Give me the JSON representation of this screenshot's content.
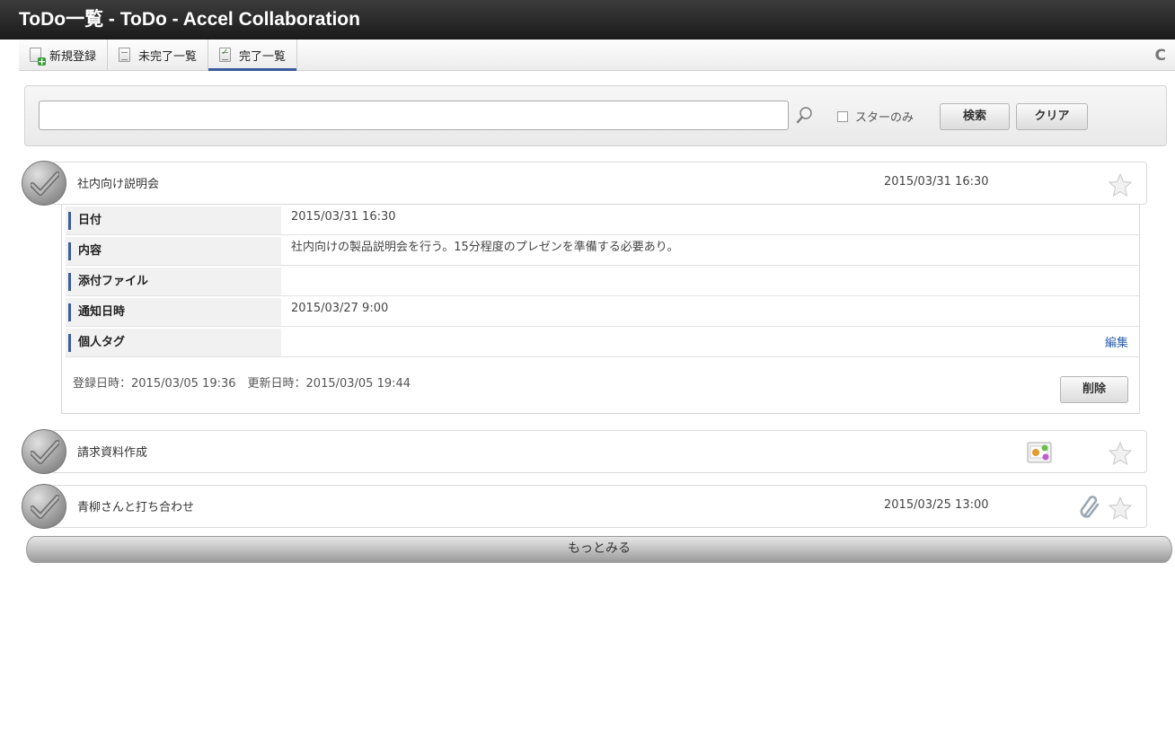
{
  "window": {
    "title": "ToDo一覧 - ToDo - Accel Collaboration"
  },
  "toolbar": {
    "new_label": "新規登録",
    "incomplete_label": "未完了一覧",
    "complete_label": "完了一覧",
    "active_tab": "完了一覧",
    "refresh_icon": "refresh-icon"
  },
  "search": {
    "value": "",
    "placeholder": "",
    "star_only_label": "スターのみ",
    "star_only_checked": false,
    "search_label": "検索",
    "clear_label": "クリア"
  },
  "todos": [
    {
      "title": "社内向け説明会",
      "date": "2015/03/31 16:30",
      "starred": false,
      "expanded": true,
      "details": {
        "date_label": "日付",
        "date_value": "2015/03/31 16:30",
        "content_label": "内容",
        "content_value": "社内向けの製品説明会を行う。15分程度のプレゼンを準備する必要あり。",
        "attachment_label": "添付ファイル",
        "attachment_value": "",
        "notify_label": "通知日時",
        "notify_value": "2015/03/27 9:00",
        "tag_label": "個人タグ",
        "tag_value": "",
        "edit_label": "編集",
        "meta": "登録日時：2015/03/05 19:36　更新日時：2015/03/05 19:44",
        "delete_label": "削除"
      }
    },
    {
      "title": "請求資料作成",
      "date": "",
      "starred": false,
      "expanded": false,
      "icon": "gallery-icon"
    },
    {
      "title": "青柳さんと打ち合わせ",
      "date": "2015/03/25 13:00",
      "starred": false,
      "expanded": false,
      "icon": "paperclip-icon"
    }
  ],
  "more_label": "もっとみる",
  "colors": {
    "accent": "#3a5c9c",
    "link": "#2a5dab",
    "titlebar": "#1f1f1f"
  }
}
